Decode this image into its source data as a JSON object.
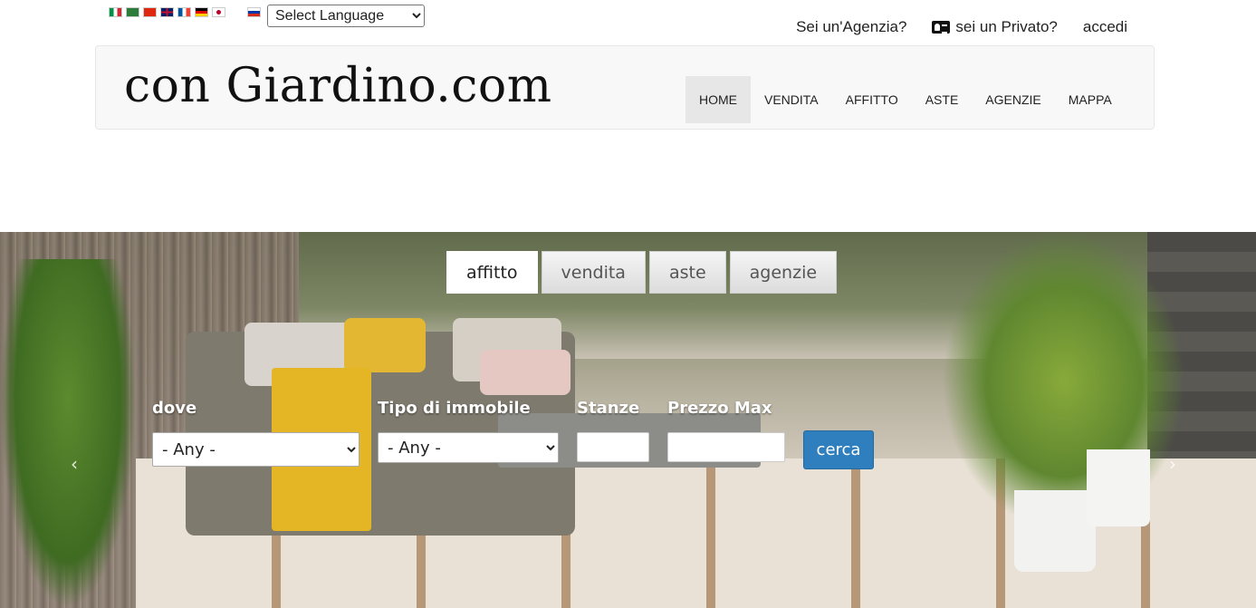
{
  "language": {
    "flags": [
      "it",
      "sa",
      "cn",
      "gb",
      "fr",
      "de",
      "jp",
      "ru"
    ],
    "select_label": "Select Language"
  },
  "toplinks": {
    "agenzia": "Sei un'Agenzia?",
    "privato": "sei un Privato?",
    "login": "accedi"
  },
  "brand": {
    "logo_text": "con Giardino.com"
  },
  "nav": {
    "items": [
      "HOME",
      "VENDITA",
      "AFFITTO",
      "ASTE",
      "AGENZIE",
      "MAPPA"
    ],
    "active": "HOME"
  },
  "search": {
    "tabs": [
      "affitto",
      "vendita",
      "aste",
      "agenzie"
    ],
    "active_tab": "affitto",
    "fields": {
      "dove_label": "dove",
      "dove_value": "- Any -",
      "tipo_label": "Tipo di immobile",
      "tipo_value": "- Any -",
      "stanze_label": "Stanze",
      "stanze_value": "",
      "prezzo_label": "Prezzo Max",
      "prezzo_value": ""
    },
    "submit_label": "cerca"
  },
  "carousel": {
    "prev_glyph": "‹",
    "next_glyph": "›"
  },
  "colors": {
    "primary_button": "#2f7fbf",
    "navbar_bg": "#f8f8f8",
    "active_nav_bg": "#e7e7e7"
  }
}
